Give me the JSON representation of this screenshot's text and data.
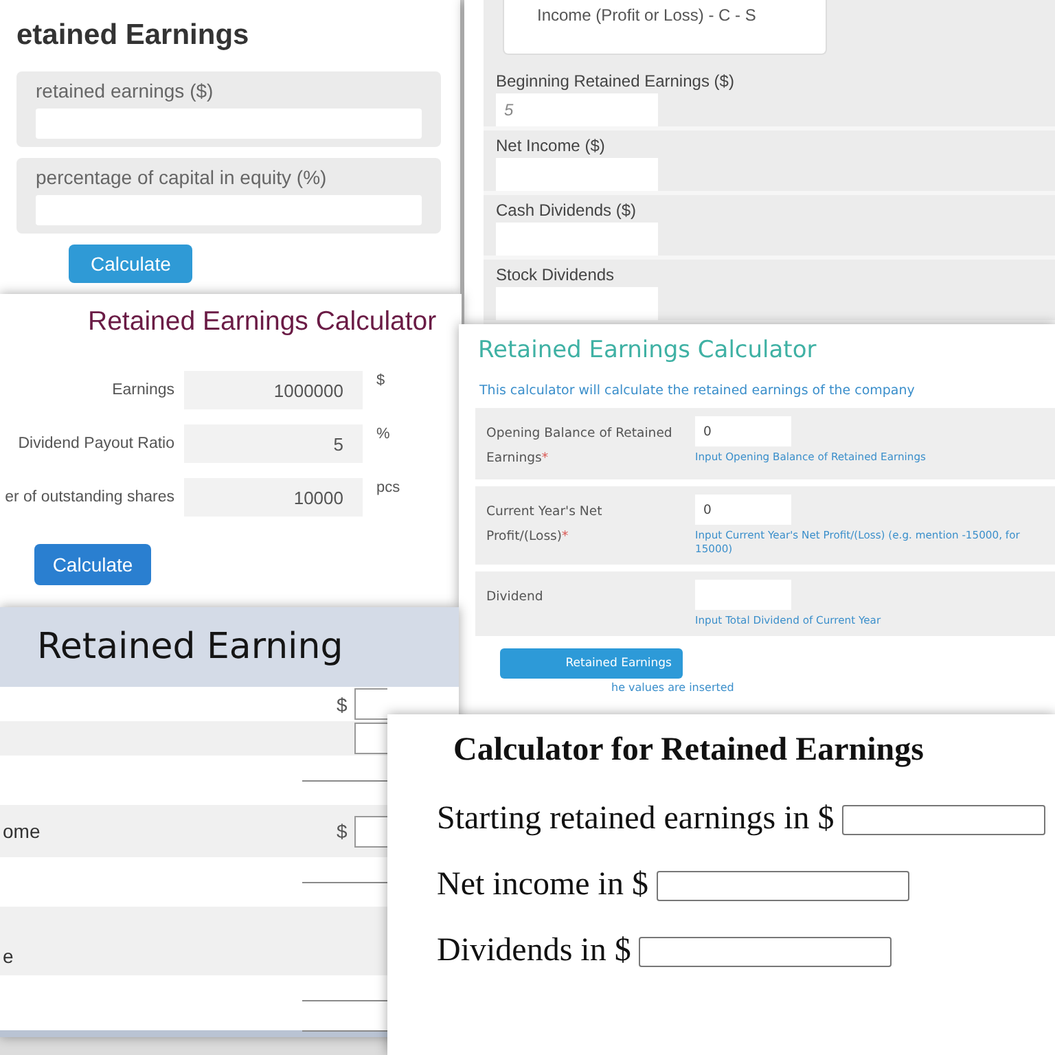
{
  "cards": [
    {
      "kind": "grey-rows",
      "title": "etained Earnings",
      "fields": [
        {
          "label": "retained earnings ($)"
        },
        {
          "label": "percentage of capital in equity (%)"
        }
      ],
      "button": "Calculate"
    },
    {
      "kind": "stacked",
      "formula": "Income (Profit or Loss) - C - S",
      "fields": [
        {
          "label": "Beginning Retained Earnings ($)",
          "placeholder": "5"
        },
        {
          "label": "Net Income ($)"
        },
        {
          "label": "Cash Dividends ($)"
        },
        {
          "label": "Stock Dividends"
        }
      ]
    },
    {
      "kind": "aligned",
      "title": "Retained Earnings Calculator",
      "fields": [
        {
          "label": "Earnings",
          "value": "1000000",
          "unit": "$"
        },
        {
          "label": "Dividend Payout Ratio",
          "value": "5",
          "unit": "%"
        },
        {
          "label": "er of outstanding shares",
          "value": "10000",
          "unit": "pcs"
        }
      ],
      "button": "Calculate"
    },
    {
      "kind": "described",
      "title": "Retained Earnings Calculator",
      "description": "This calculator will calculate the retained earnings of the company",
      "fields": [
        {
          "label": "Opening Balance of Retained Earnings",
          "mark": "*",
          "value": "0",
          "help": "Input Opening Balance of Retained Earnings"
        },
        {
          "label": "Current Year's Net Profit/(Loss)",
          "mark": "*",
          "value": "0",
          "help": "Input Current Year's Net Profit/(Loss) (e.g. mention -15000, for 15000)"
        },
        {
          "label": "Dividend",
          "help": "Input Total Dividend of Current Year"
        }
      ],
      "button": "Retained Earnings",
      "note": "he values are inserted"
    },
    {
      "kind": "banded",
      "title": "Retained Earning",
      "rows": [
        {
          "kind": "field",
          "unit": "$"
        },
        {
          "kind": "field"
        },
        {
          "kind": "rule"
        },
        {
          "kind": "field",
          "label": "ome",
          "unit": "$"
        },
        {
          "kind": "rule"
        },
        {
          "kind": "text",
          "label": "e"
        },
        {
          "kind": "rule"
        },
        {
          "kind": "rule"
        }
      ]
    },
    {
      "kind": "plain",
      "title": "Calculator for Retained Earnings",
      "fields": [
        {
          "label": "Starting retained earnings in $"
        },
        {
          "label": "Net income in $"
        },
        {
          "label": "Dividends in $"
        }
      ]
    }
  ]
}
